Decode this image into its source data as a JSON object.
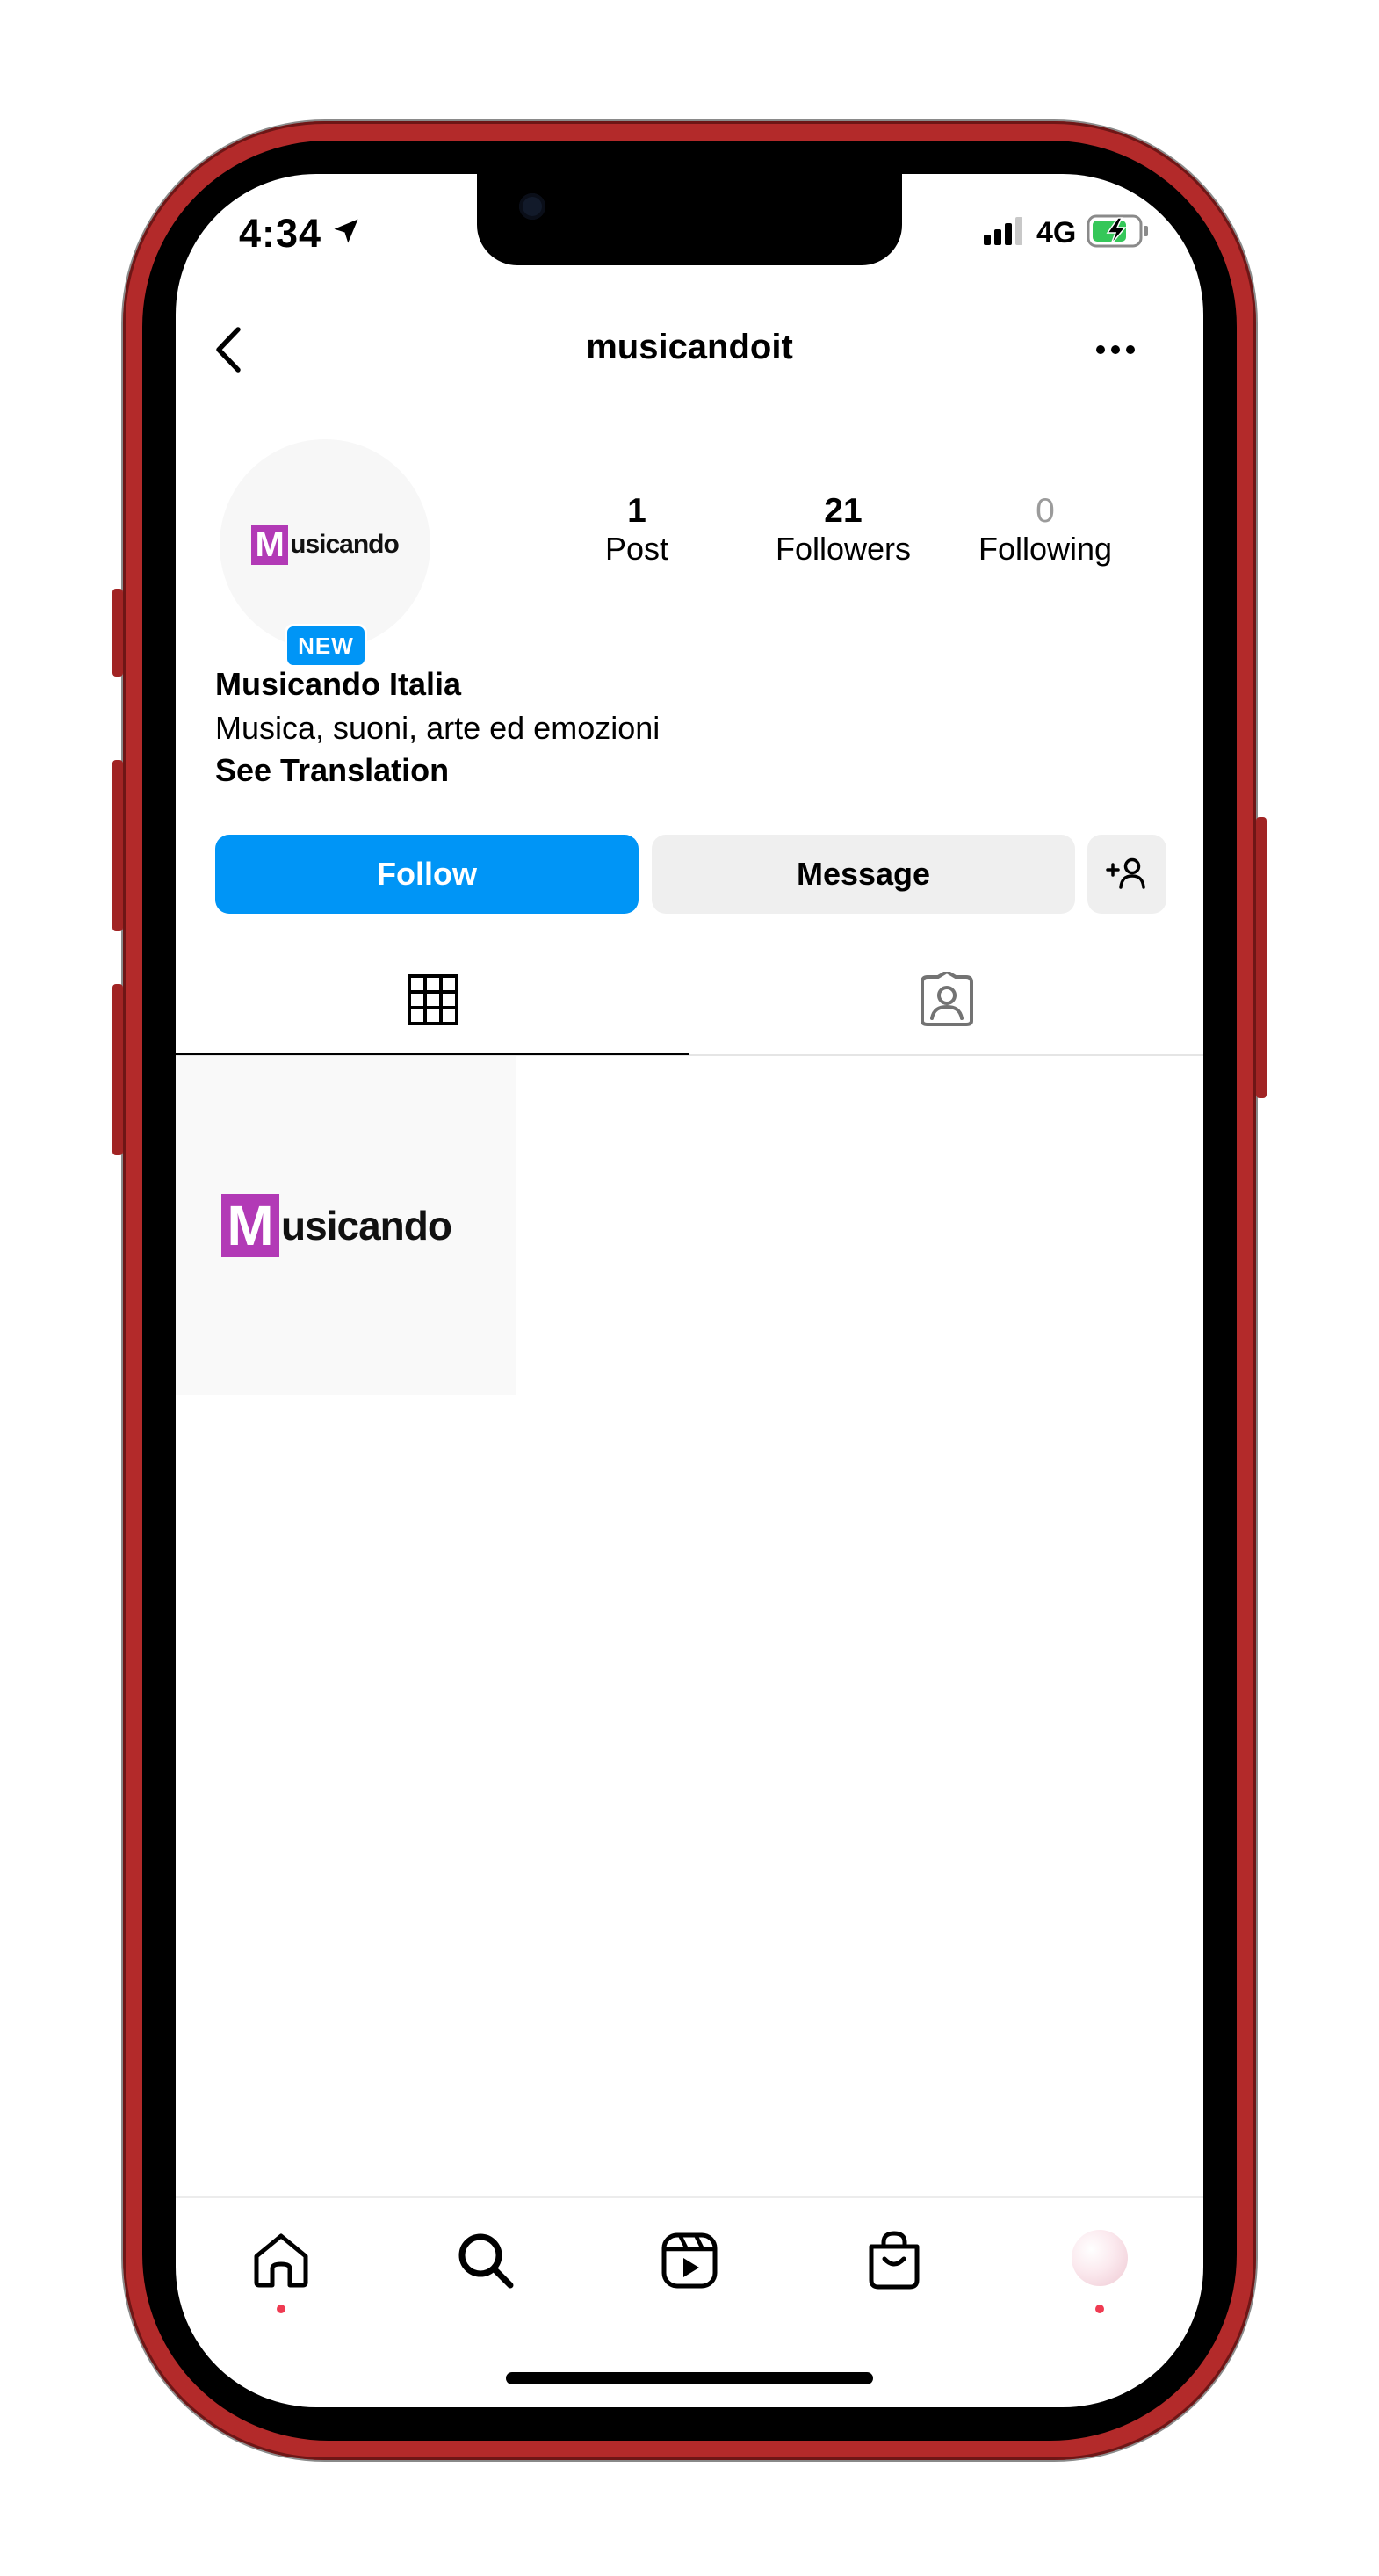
{
  "status": {
    "time": "4:34",
    "network": "4G"
  },
  "header": {
    "username": "musicandoit"
  },
  "profile": {
    "logo_letter": "M",
    "logo_text": "usicando",
    "new_badge": "NEW",
    "display_name": "Musicando Italia",
    "bio": "Musica, suoni, arte ed emozioni",
    "see_translation": "See Translation"
  },
  "stats": {
    "posts": {
      "count": "1",
      "label": "Post"
    },
    "followers": {
      "count": "21",
      "label": "Followers"
    },
    "following": {
      "count": "0",
      "label": "Following"
    }
  },
  "actions": {
    "follow": "Follow",
    "message": "Message"
  },
  "tabs": [
    {
      "icon": "grid-icon",
      "active": true
    },
    {
      "icon": "tagged-icon",
      "active": false
    }
  ],
  "post_grid": [
    {
      "logo_letter": "M",
      "logo_text": "usicando"
    }
  ],
  "bottom_nav": [
    "home-icon",
    "search-icon",
    "reels-icon",
    "shop-icon",
    "profile-avatar"
  ],
  "colors": {
    "follow": "#0095f6",
    "logo": "#b23ab6",
    "phone": "#b32a2a",
    "notification_dot": "#ef3b52"
  }
}
